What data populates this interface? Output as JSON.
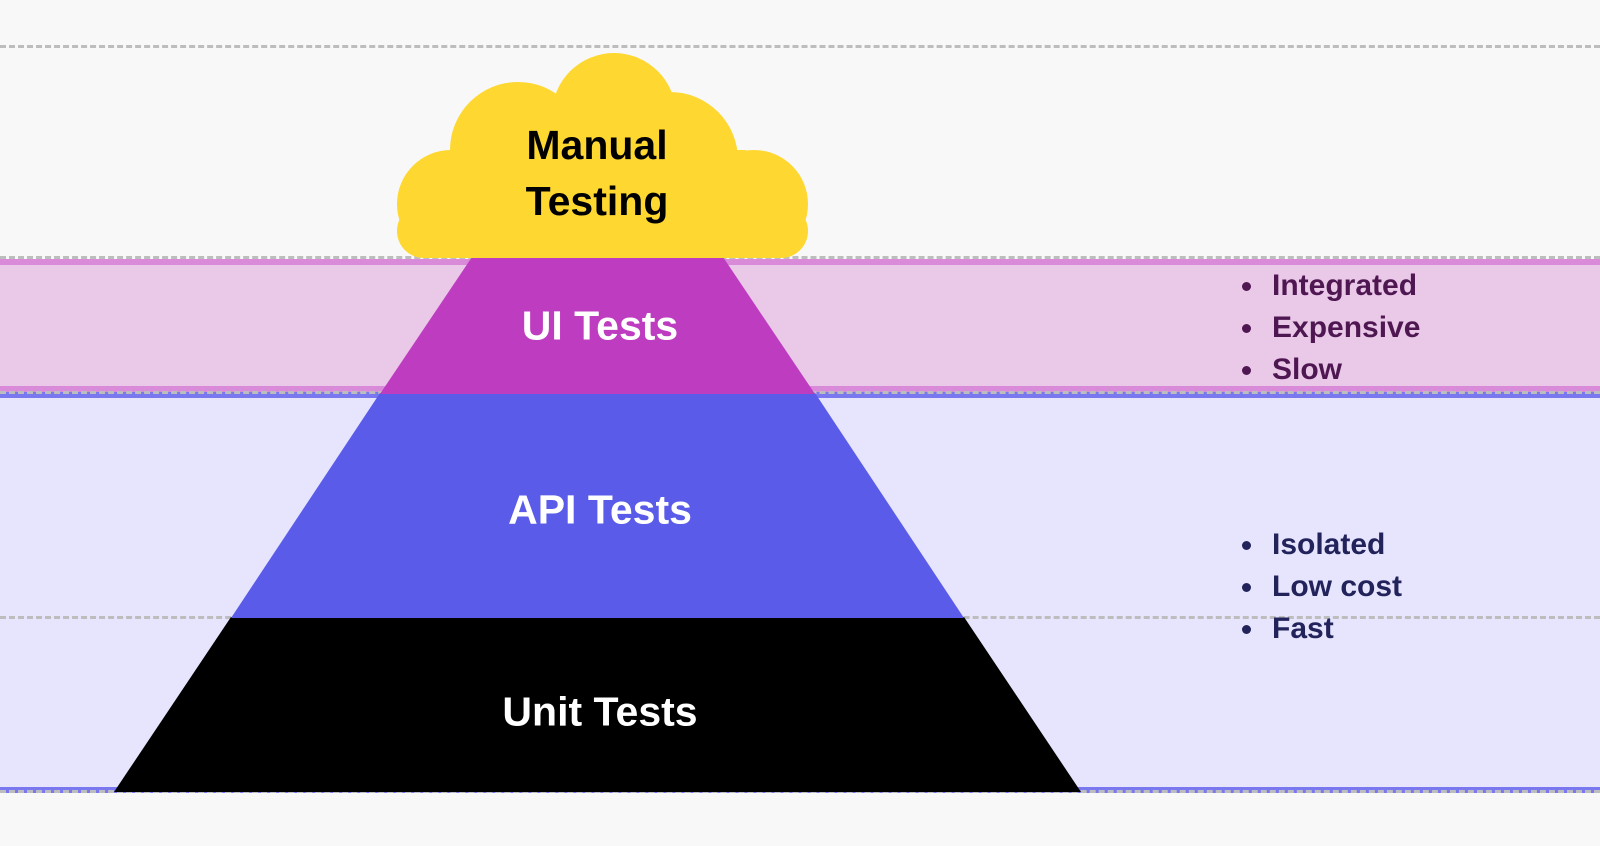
{
  "colors": {
    "background": "#f8f8f8",
    "cloud": "#fed731",
    "ui_tier": "#be3cc0",
    "api_tier": "#5a5ce9",
    "unit_tier": "#000000",
    "ui_band": "#e9c8e8",
    "ui_band_border": "#d98bd9",
    "low_band": "#e7e5fd",
    "low_band_border": "#7a78ee",
    "dashed_line": "#bdbdbd",
    "top_list_text": "#4f1752",
    "bottom_list_text": "#23235c"
  },
  "pyramid": {
    "cloud": {
      "line1": "Manual",
      "line2": "Testing"
    },
    "tiers": [
      {
        "id": "ui",
        "label": "UI Tests"
      },
      {
        "id": "api",
        "label": "API Tests"
      },
      {
        "id": "unit",
        "label": "Unit Tests"
      }
    ]
  },
  "characteristics": {
    "top": [
      "Integrated",
      "Expensive",
      "Slow"
    ],
    "bottom": [
      "Isolated",
      "Low cost",
      "Fast"
    ]
  }
}
